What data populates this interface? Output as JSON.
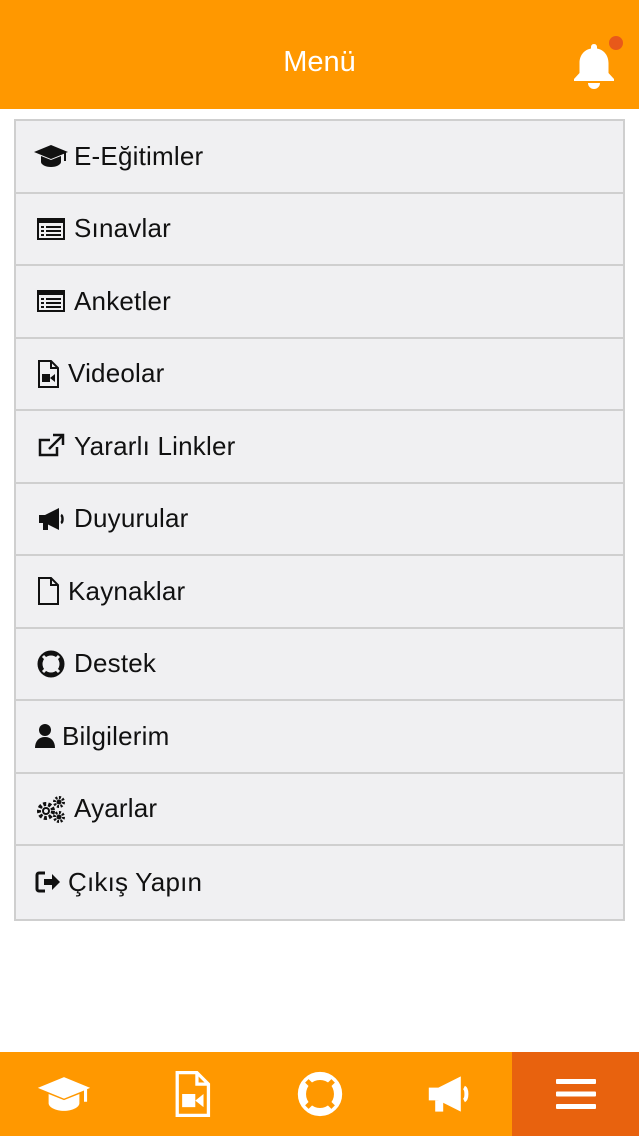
{
  "header": {
    "title": "Menü",
    "notification_icon": "bell-icon",
    "has_unread": true
  },
  "menu": {
    "items": [
      {
        "label": "E-Eğitimler",
        "icon": "graduation-cap-icon"
      },
      {
        "label": "Sınavlar",
        "icon": "list-alt-icon"
      },
      {
        "label": "Anketler",
        "icon": "list-alt-icon"
      },
      {
        "label": "Videolar",
        "icon": "file-video-icon"
      },
      {
        "label": "Yararlı Linkler",
        "icon": "external-link-icon"
      },
      {
        "label": "Duyurular",
        "icon": "bullhorn-icon"
      },
      {
        "label": "Kaynaklar",
        "icon": "file-icon"
      },
      {
        "label": "Destek",
        "icon": "life-ring-icon"
      },
      {
        "label": "Bilgilerim",
        "icon": "user-icon"
      },
      {
        "label": "Ayarlar",
        "icon": "cogs-icon"
      },
      {
        "label": "Çıkış Yapın",
        "icon": "sign-out-icon"
      }
    ]
  },
  "bottom_nav": {
    "tabs": [
      {
        "icon": "graduation-cap-icon",
        "active": false
      },
      {
        "icon": "file-video-icon",
        "active": false
      },
      {
        "icon": "life-ring-icon",
        "active": false
      },
      {
        "icon": "bullhorn-icon",
        "active": false
      },
      {
        "icon": "menu-icon",
        "active": true
      }
    ]
  },
  "colors": {
    "brand": "#ff9800",
    "active_tab": "#e8620e",
    "notification_dot": "#e8591a"
  }
}
